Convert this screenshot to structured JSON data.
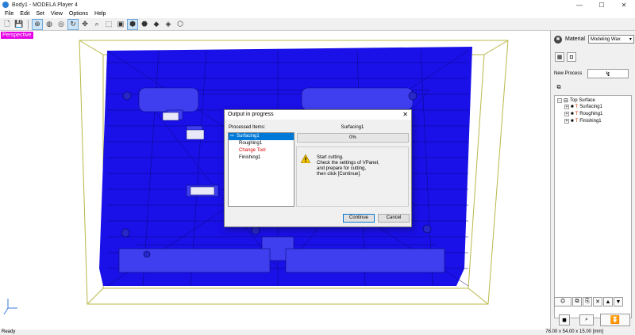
{
  "window": {
    "title": "Body1 - MODELA Player 4",
    "minimize": "—",
    "maximize": "☐",
    "close": "✕"
  },
  "menu": [
    "File",
    "Edit",
    "Set",
    "View",
    "Options",
    "Help"
  ],
  "viewport": {
    "label": "Perspective"
  },
  "panel": {
    "material_label": "Material",
    "material_value": "Modeling Wax",
    "new_process_label": "New Process",
    "tree": {
      "root": "Top Surface",
      "items": [
        "Surfacing1",
        "Roughing1",
        "Finishing1"
      ]
    }
  },
  "dialog": {
    "title": "Output in progress",
    "processed_items_label": "Processed Items:",
    "items": [
      "Surfacing1",
      "Roughing1",
      "Change Tool",
      "Finishing1"
    ],
    "current_process": "Surfacing1",
    "progress_text": "0%",
    "progress": 0,
    "message_lines": [
      "Start cutting.",
      "Check the settings of VPanel,",
      "and prepare for cutting,",
      "then click [Continue]."
    ],
    "continue_label": "Continue",
    "cancel_label": "Cancel"
  },
  "status": {
    "left": "Ready",
    "right": "76.00 x 54.00 x 15.00 [mm]"
  },
  "colors": {
    "mesh": "#1a10e8",
    "accent": "#0078d7",
    "perspective": "#e600e6",
    "warning": "#f5c400"
  }
}
